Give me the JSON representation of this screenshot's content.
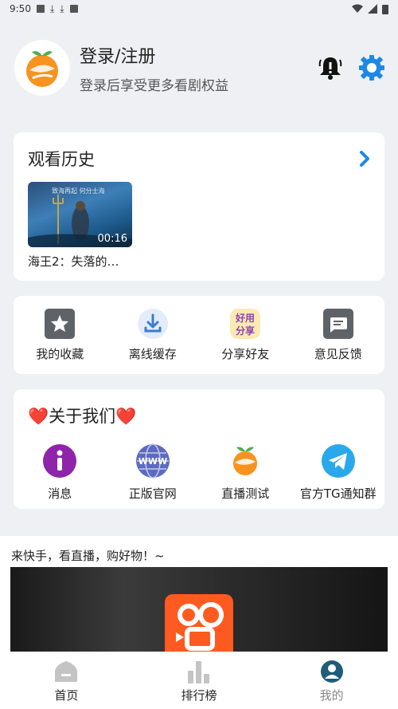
{
  "status": {
    "time": "9:50"
  },
  "profile": {
    "title": "登录/注册",
    "subtitle": "登录后享受更多看剧权益"
  },
  "history": {
    "title": "观看历史",
    "items": [
      {
        "title": "海王2：失落的…",
        "duration": "00:16",
        "poster_text": "致海再起  何分士海"
      }
    ]
  },
  "features": [
    {
      "label": "我的收藏",
      "icon": "star-icon"
    },
    {
      "label": "离线缓存",
      "icon": "download-icon"
    },
    {
      "label": "分享好友",
      "icon": "share-icon"
    },
    {
      "label": "意见反馈",
      "icon": "feedback-icon"
    }
  ],
  "about": {
    "title": "❤️关于我们❤️",
    "items": [
      {
        "label": "消息",
        "icon": "info-icon"
      },
      {
        "label": "正版官网",
        "icon": "www-globe-icon"
      },
      {
        "label": "直播测试",
        "icon": "orange-logo-icon"
      },
      {
        "label": "官方TG通知群",
        "icon": "telegram-icon"
      }
    ]
  },
  "promo": {
    "title": "来快手，看直播，购好物！~"
  },
  "tabs": [
    {
      "label": "首页",
      "icon": "home-icon"
    },
    {
      "label": "排行榜",
      "icon": "ranking-icon"
    },
    {
      "label": "我的",
      "icon": "profile-icon"
    }
  ],
  "colors": {
    "accent": "#1e88e5",
    "heart": "#e53935",
    "orange": "#f7931e"
  }
}
